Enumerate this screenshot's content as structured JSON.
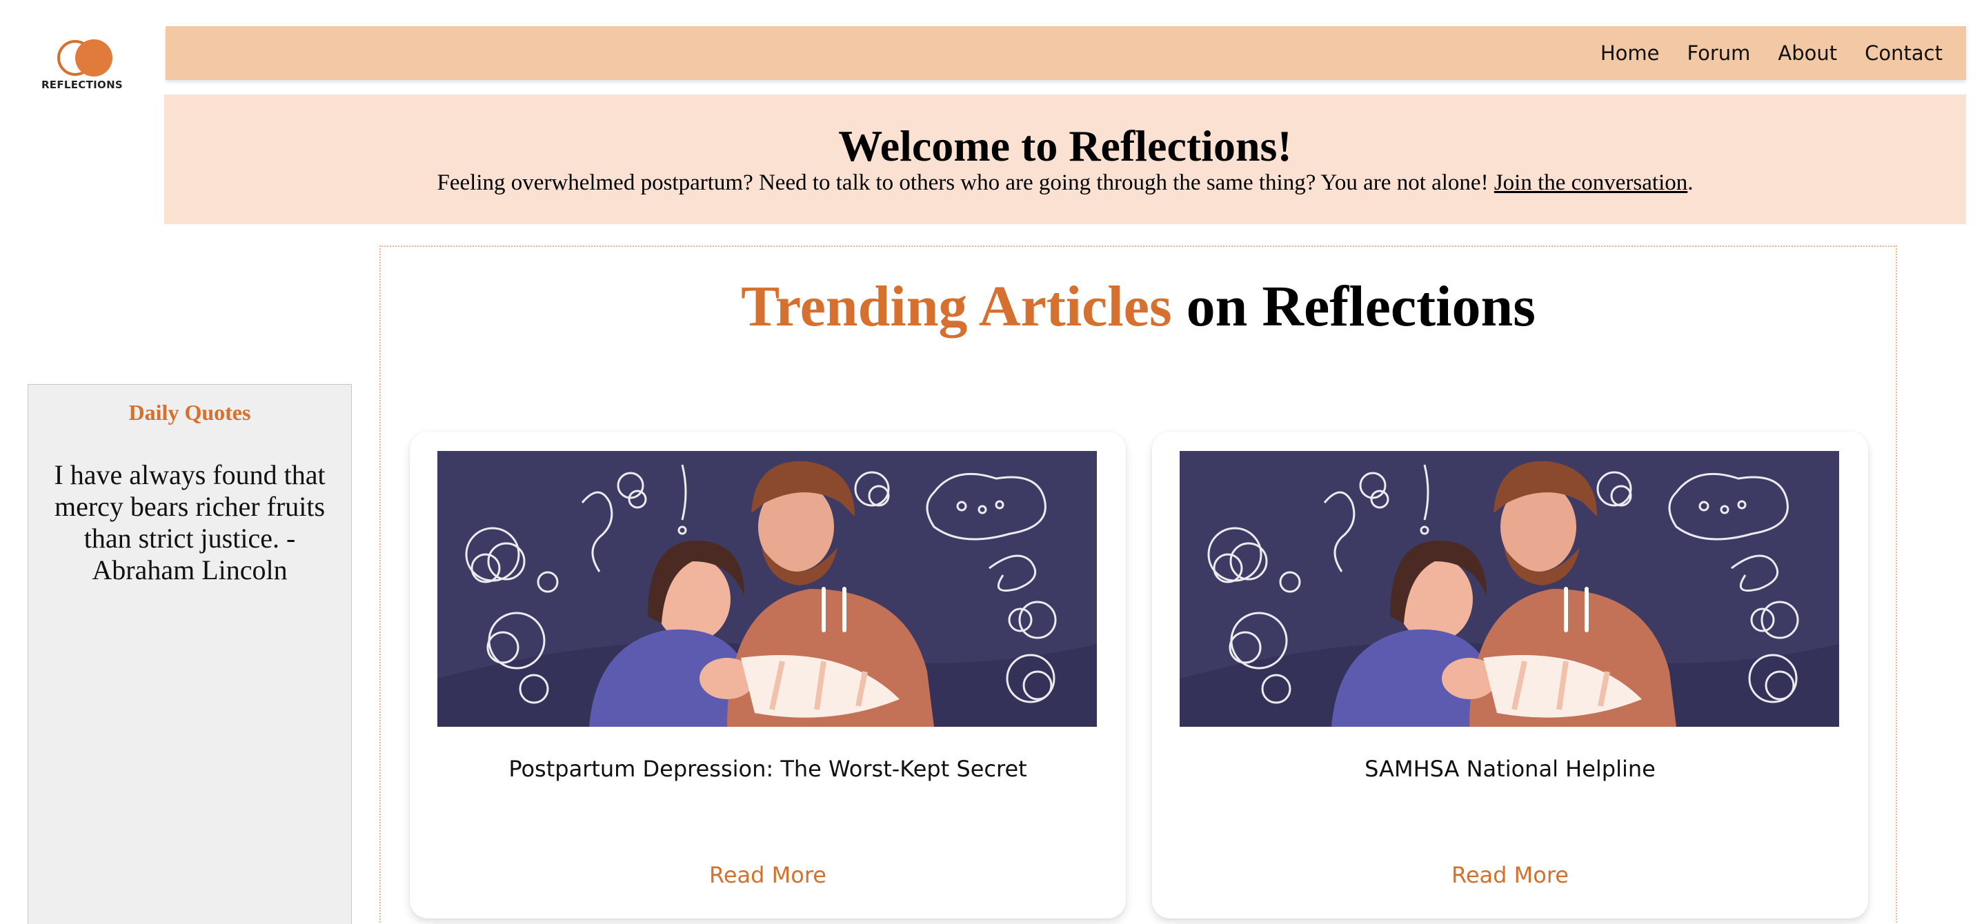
{
  "brand": {
    "logo_text": "REFLECTIONS",
    "accent_color": "#d5702f",
    "nav_color": "#f3c8a5",
    "hero_color": "#fae1d1"
  },
  "nav": {
    "items": [
      {
        "label": "Home"
      },
      {
        "label": "Forum"
      },
      {
        "label": "About"
      },
      {
        "label": "Contact"
      }
    ]
  },
  "hero": {
    "title": "Welcome to Reflections!",
    "subtitle": "Feeling overwhelmed postpartum? Need to talk to others who are going through the same thing? You are not alone! ",
    "link_text": "Join the conversation",
    "trailing": "."
  },
  "sidebar": {
    "title": "Daily Quotes",
    "quote": "I have always found that mercy bears richer fruits than strict justice. - Abraham Lincoln"
  },
  "trending": {
    "title_accent": "Trending Articles",
    "title_rest": " on Reflections",
    "cards": [
      {
        "title": "Postpartum Depression: The Worst-Kept Secret",
        "button": "Read More",
        "image_icon": "postpartum-family-illustration"
      },
      {
        "title": "SAMHSA National Helpline",
        "button": "Read More",
        "image_icon": "postpartum-family-illustration"
      }
    ]
  }
}
